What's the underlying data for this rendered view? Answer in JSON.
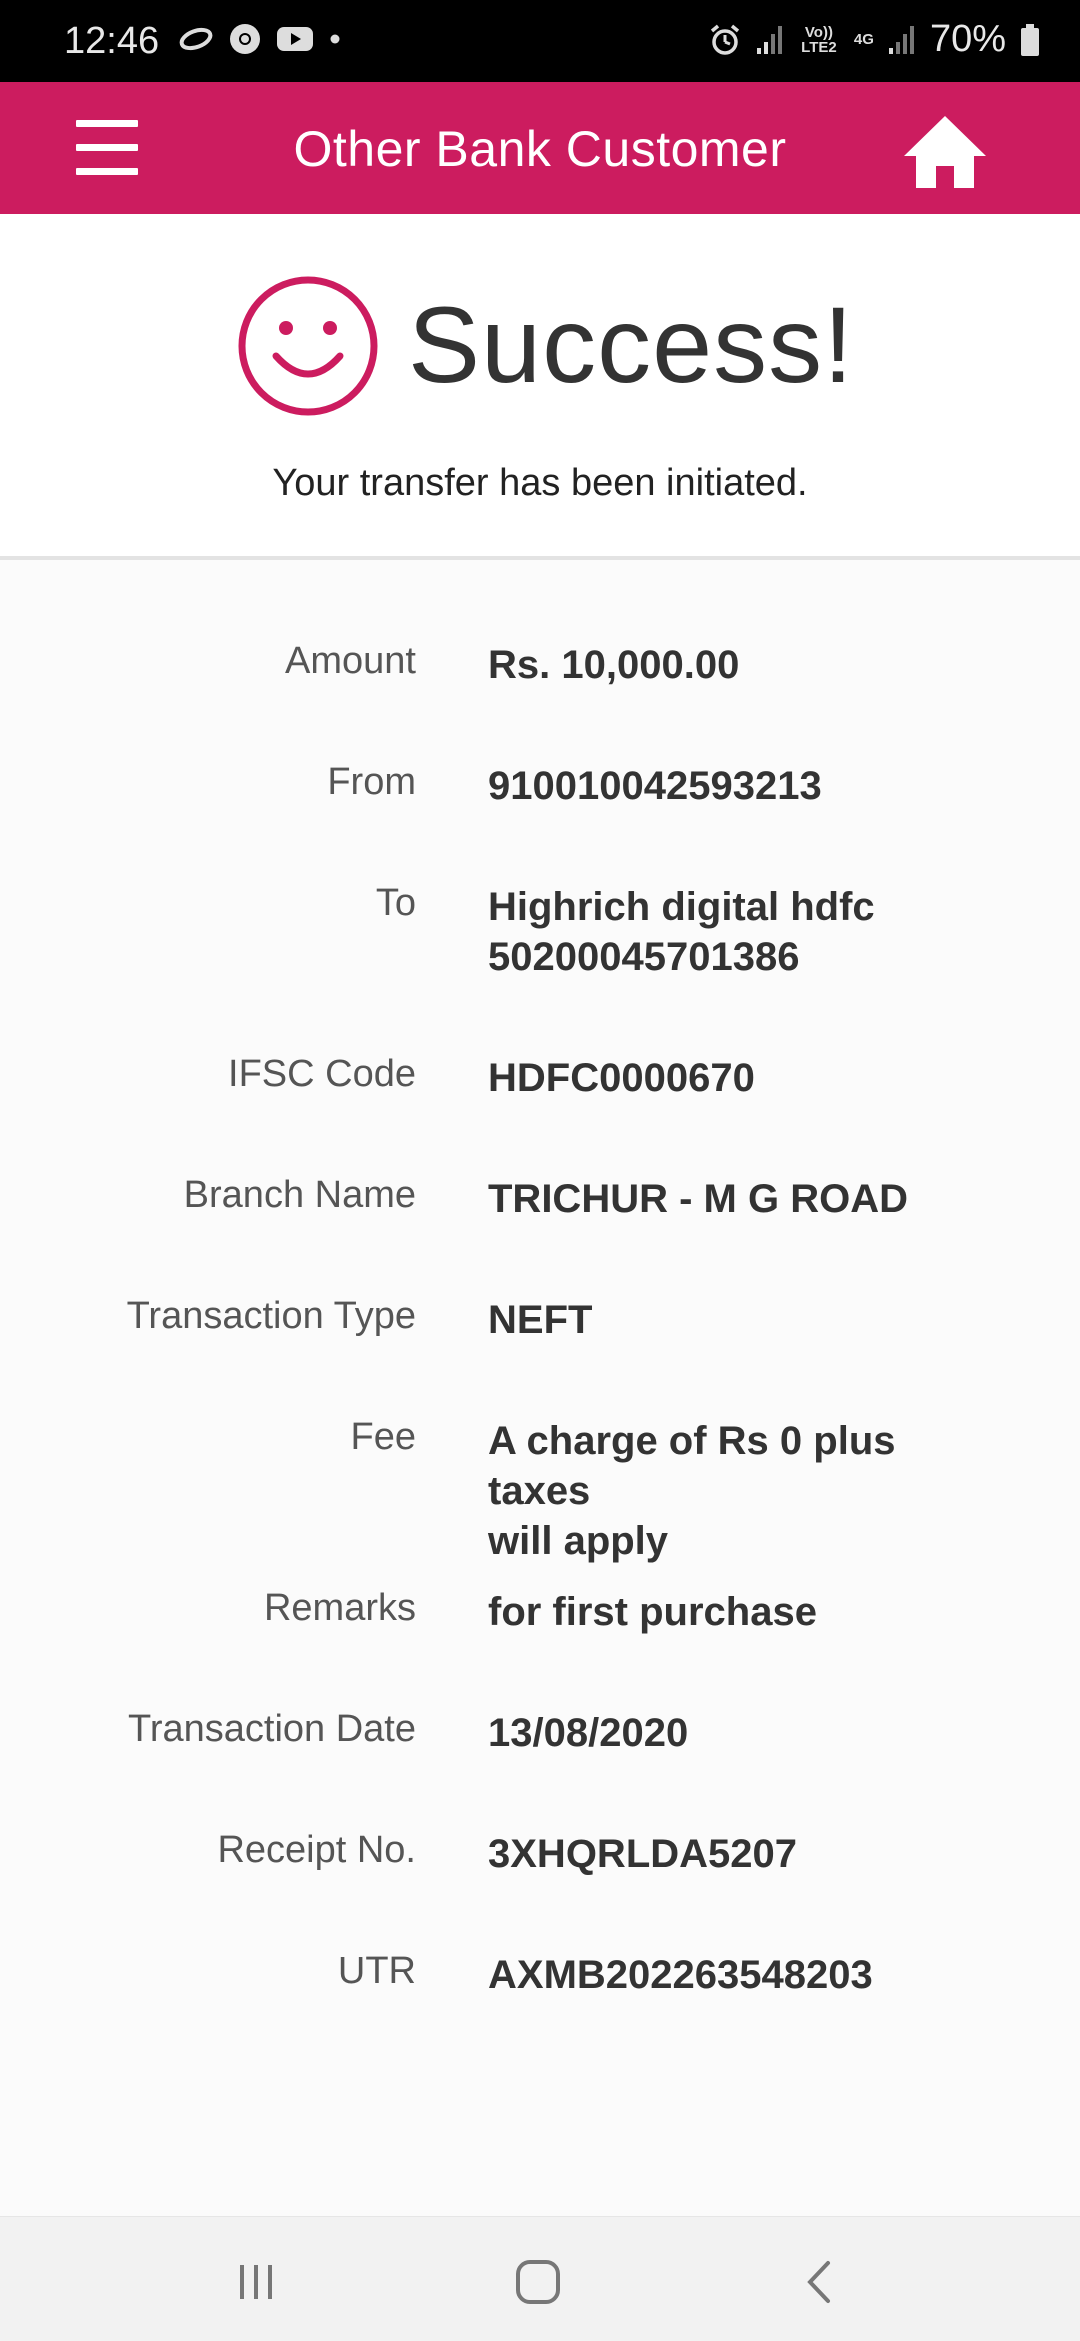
{
  "status_bar": {
    "time": "12:46",
    "battery": "70%",
    "network_label_1": "Vo)) LTE2",
    "network_label_2": "4G",
    "icons": [
      "link-icon",
      "chrome-icon",
      "youtube-icon",
      "dot-icon",
      "alarm-icon",
      "signal-icon",
      "signal-icon",
      "battery-icon"
    ]
  },
  "appbar": {
    "title": "Other Bank Customer",
    "menu_icon": "hamburger-menu-icon",
    "home_icon": "home-icon",
    "color": "#cc1c5f"
  },
  "success": {
    "heading": "Success!",
    "message": "Your transfer has been initiated.",
    "icon": "smiley-icon"
  },
  "details": [
    {
      "label": "Amount",
      "value": "Rs. 10,000.00"
    },
    {
      "label": "From",
      "value": "910010042593213"
    },
    {
      "label": "To",
      "value": "Highrich digital hdfc\n50200045701386"
    },
    {
      "label": "IFSC Code",
      "value": "HDFC0000670"
    },
    {
      "label": "Branch Name",
      "value": "TRICHUR - M G ROAD"
    },
    {
      "label": "Transaction Type",
      "value": "NEFT"
    },
    {
      "label": "Fee",
      "value": "A charge of Rs 0 plus taxes\nwill apply"
    },
    {
      "label": "Remarks",
      "value": "for first purchase"
    },
    {
      "label": "Transaction Date",
      "value": "13/08/2020"
    },
    {
      "label": "Receipt No.",
      "value": "3XHQRLDA5207"
    },
    {
      "label": "UTR",
      "value": "AXMB202263548203"
    }
  ],
  "navbar": {
    "icons": [
      "recent-apps-icon",
      "home-circle-icon",
      "back-icon"
    ]
  }
}
